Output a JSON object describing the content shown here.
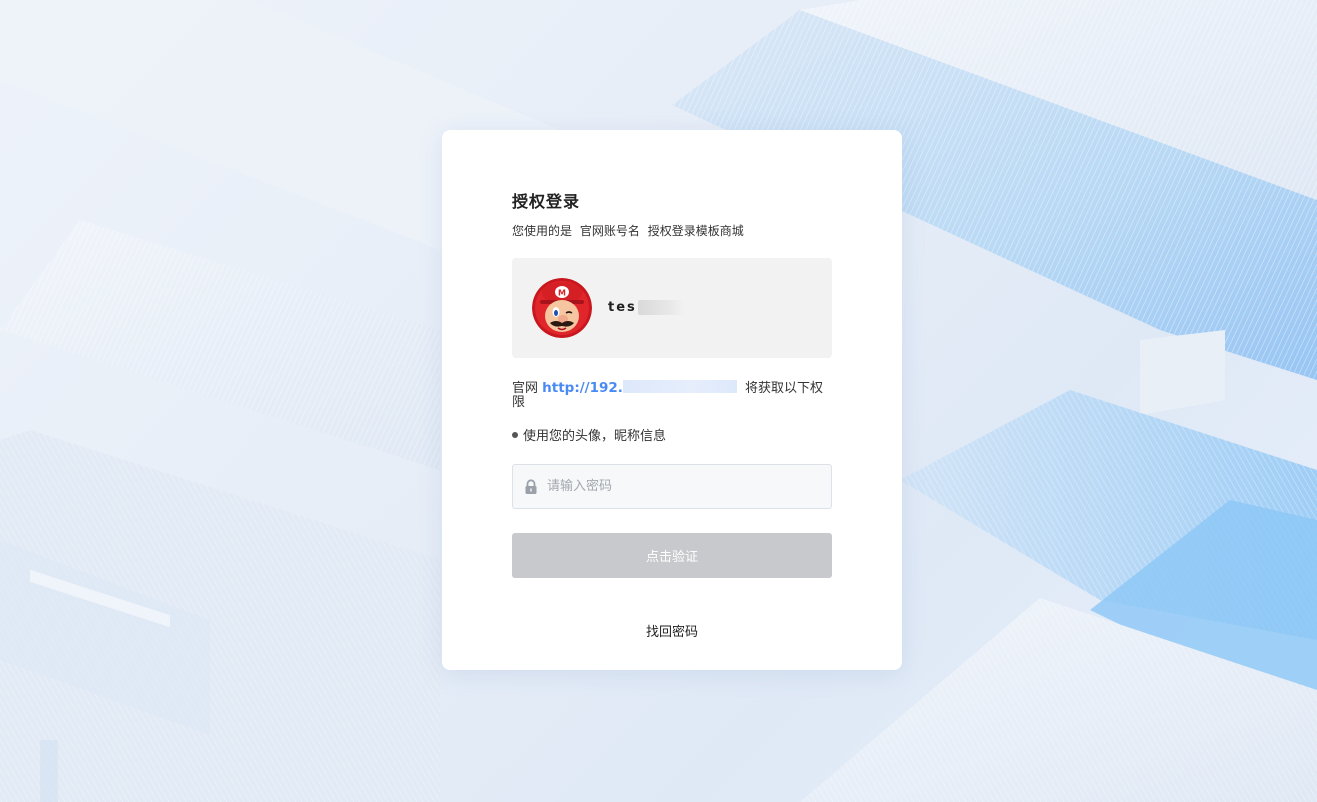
{
  "card": {
    "title": "授权登录",
    "subtitle_prefix": "您使用的是",
    "subtitle_account": "官网账号名",
    "subtitle_suffix": "授权登录模板商城"
  },
  "user": {
    "name_visible": "tes",
    "avatar": "mario-avatar"
  },
  "permission": {
    "site_label": "官网",
    "url_visible": "http://192.",
    "suffix": "将获取以下权限"
  },
  "scopes": [
    {
      "label": "使用您的头像，昵称信息"
    }
  ],
  "password": {
    "placeholder": "请输入密码",
    "value": "",
    "icon": "lock-icon"
  },
  "verify_button": {
    "label": "点击验证"
  },
  "forgot_link": {
    "label": "找回密码"
  },
  "colors": {
    "accent_link": "#4a8af4",
    "button_disabled": "#c8c9cc",
    "user_box_bg": "#f2f2f2"
  }
}
